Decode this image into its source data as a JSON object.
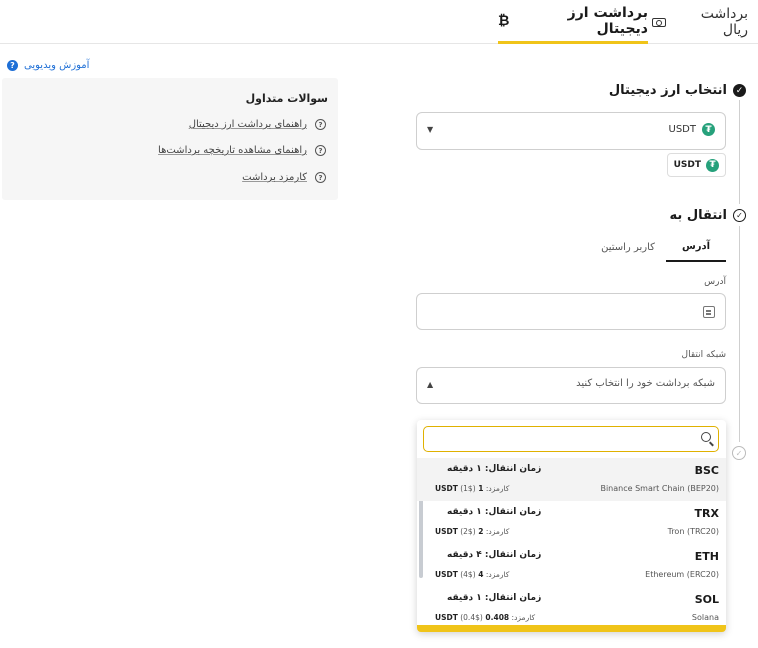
{
  "tabs": {
    "crypto_withdraw": "برداشت ارز دیجیتال",
    "crypto_symbol": "₿",
    "rial_withdraw": "برداشت ریال"
  },
  "help": {
    "video_tutorial": "آموزش ویدیویی",
    "faq_title": "سوالات متداول",
    "faq_items": [
      "راهنمای برداشت ارز دیجیتال",
      "راهنمای مشاهده تاریخچه برداشت‌ها",
      "کارمزد برداشت"
    ]
  },
  "form": {
    "step1_title": "انتخاب ارز دیجیتال",
    "selected_coin": "USDT",
    "chip_coin": "USDT",
    "step2_title": "انتقال به",
    "subtab_address": "آدرس",
    "subtab_user": "کاربر راستین",
    "address_label": "آدرس",
    "address_value": "",
    "network_label": "شبکه انتقال",
    "network_placeholder": "شبکه برداشت خود را انتخاب کنید",
    "search_value": ""
  },
  "networks": [
    {
      "code": "BSC",
      "name": "Binance Smart Chain (BEP20)",
      "time": "زمان انتقال: ۱ دقیقه",
      "fee_label": "کارمزد:",
      "fee_value": "1 USDT",
      "fee_usd": "(1$)"
    },
    {
      "code": "TRX",
      "name": "Tron (TRC20)",
      "time": "زمان انتقال: ۱ دقیقه",
      "fee_label": "کارمزد:",
      "fee_value": "2 USDT",
      "fee_usd": "(2$)"
    },
    {
      "code": "ETH",
      "name": "Ethereum (ERC20)",
      "time": "زمان انتقال: ۴ دقیقه",
      "fee_label": "کارمزد:",
      "fee_value": "4 USDT",
      "fee_usd": "(4$)"
    },
    {
      "code": "SOL",
      "name": "Solana",
      "time": "زمان انتقال: ۱ دقیقه",
      "fee_label": "کارمزد:",
      "fee_value": "0.408 USDT",
      "fee_usd": "(0.4$)"
    }
  ],
  "colors": {
    "accent": "#f0c419",
    "tether": "#26a17b",
    "link": "#1e6fd6"
  }
}
